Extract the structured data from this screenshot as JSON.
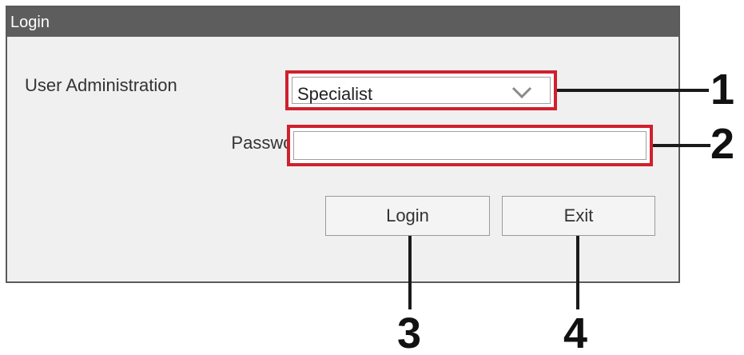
{
  "dialog": {
    "title": "Login"
  },
  "form": {
    "user_admin_label": "User Administration",
    "user_admin_value": "Specialist",
    "password_label": "Password",
    "password_value": ""
  },
  "buttons": {
    "login_label": "Login",
    "exit_label": "Exit"
  },
  "callouts": {
    "one": "1",
    "two": "2",
    "three": "3",
    "four": "4"
  },
  "colors": {
    "highlight": "#d0202e",
    "titlebar": "#5d5d5d",
    "dialog_bg": "#f0f0f0",
    "callout_line": "#1a1a1a"
  },
  "icons": {
    "dropdown": "chevron-down-icon"
  }
}
